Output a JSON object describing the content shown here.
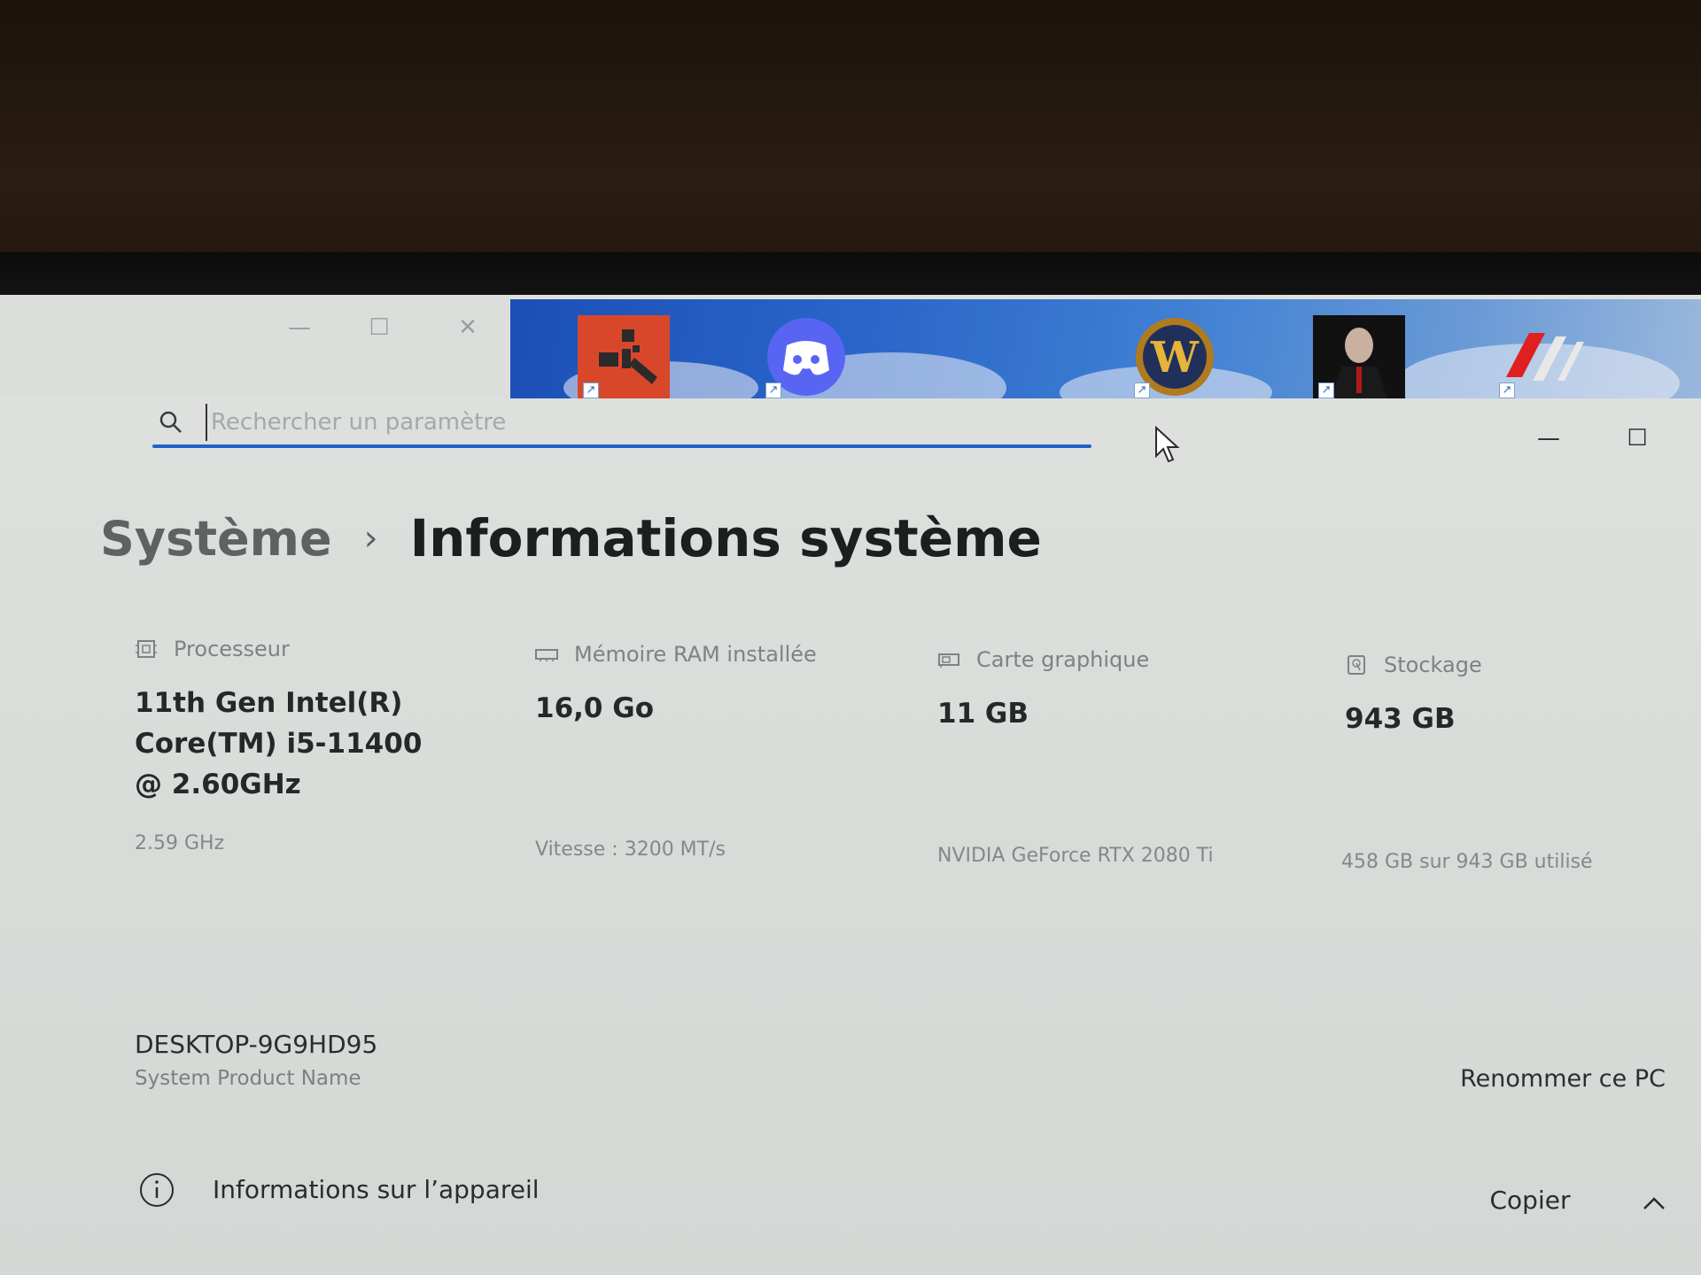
{
  "search": {
    "placeholder": "Rechercher un paramètre"
  },
  "breadcrumb": {
    "parent": "Système",
    "separator": "›",
    "current": "Informations système"
  },
  "specs": [
    {
      "label": "Processeur",
      "value": "11th Gen Intel(R) Core(TM) i5-11400 @ 2.60GHz",
      "sub": "2.59 GHz",
      "icon": "processor-icon"
    },
    {
      "label": "Mémoire RAM installée",
      "value": "16,0 Go",
      "sub": "Vitesse : 3200 MT/s",
      "icon": "memory-icon"
    },
    {
      "label": "Carte graphique",
      "value": "11 GB",
      "sub": "NVIDIA GeForce RTX 2080 Ti",
      "icon": "graphics-card-icon"
    },
    {
      "label": "Stockage",
      "value": "943 GB",
      "sub": "458 GB sur 943 GB utilisé",
      "icon": "storage-icon"
    }
  ],
  "device": {
    "name": "DESKTOP-9G9HD95",
    "model": "System Product Name",
    "rename_label": "Renommer ce PC"
  },
  "device_info": {
    "label": "Informations sur l’appareil",
    "copy_label": "Copier"
  },
  "desktop_icons": [
    "rust-icon",
    "discord-icon",
    "world-of-warcraft-icon",
    "hitman-icon",
    "msi-icon"
  ],
  "colors": {
    "accent": "#1f63c9",
    "background": "#dcdedc",
    "text_primary": "#1d1f1f",
    "text_secondary": "#7e8281"
  }
}
